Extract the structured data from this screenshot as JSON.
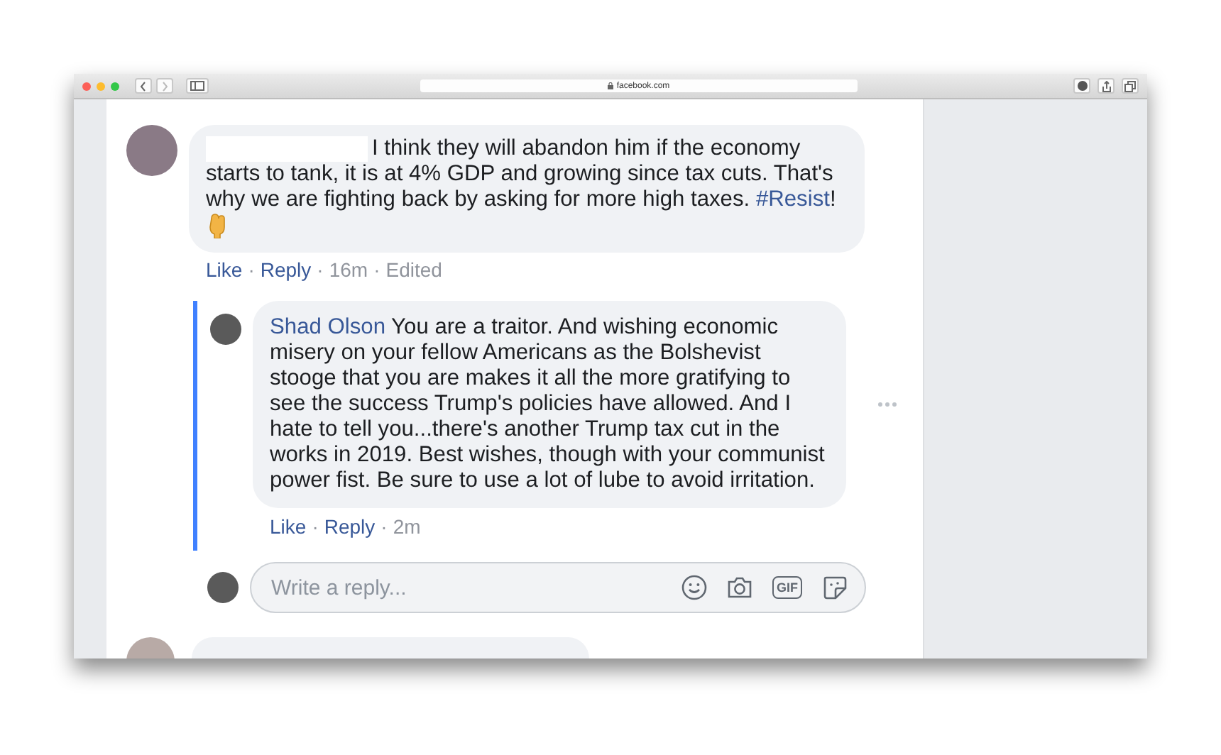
{
  "browser": {
    "address": "facebook.com"
  },
  "comment": {
    "text": "I think they will abandon him if the economy starts to tank, it is at 4% GDP and growing since tax cuts. That's why we are fighting back by asking for more high taxes.",
    "hashtag": "#Resist",
    "after": "!",
    "actions": [
      "Like",
      "Reply"
    ],
    "time": "16m",
    "edited": "Edited"
  },
  "reply": {
    "author": "Shad Olson",
    "text": "You are a traitor. And wishing economic misery on your fellow Americans as the Bolshevist stooge that you are makes it all the more gratifying to see the success Trump's policies have allowed. And I hate to tell you...there's another Trump tax cut in the works in 2019. Best wishes, though with your communist power fist. Be sure to use a lot of lube to avoid irritation.",
    "actions": [
      "Like",
      "Reply"
    ],
    "time": "2m"
  },
  "separator": "·",
  "composer": {
    "placeholder": "Write a reply...",
    "gif_label": "GIF"
  }
}
